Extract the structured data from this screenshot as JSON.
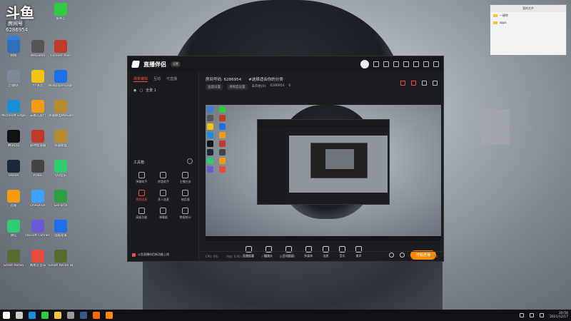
{
  "desktop": {
    "room_badge": {
      "big": "斗鱼",
      "label": "房间号",
      "number": "6286954"
    },
    "icons": [
      {
        "label": "此电脑",
        "color": "#3b7dd8"
      },
      {
        "label": "爱奇艺",
        "color": "#2ecc40"
      },
      {
        "label": "网络",
        "color": "#2d6fb9"
      },
      {
        "label": "WeGame",
        "color": "#555"
      },
      {
        "label": "Forever Plan",
        "color": "#c0392b"
      },
      {
        "label": "回收站",
        "color": "#7a8a99"
      },
      {
        "label": "YY语音",
        "color": "#f1c40f"
      },
      {
        "label": "WallpaperEngine",
        "color": "#1f6feb"
      },
      {
        "label": "Microsoft Edge",
        "color": "#1a8fd8"
      },
      {
        "label": "去哪儿旅行",
        "color": "#f39c12"
      },
      {
        "label": "英雄联盟WeGame版",
        "color": "#b88a2e"
      },
      {
        "label": "腾讯QQ",
        "color": "#111"
      },
      {
        "label": "雷神加速器",
        "color": "#c0392b"
      },
      {
        "label": "英雄联盟",
        "color": "#b88a2e"
      },
      {
        "label": "Steam",
        "color": "#1b2838"
      },
      {
        "label": "PUBG",
        "color": "#444"
      },
      {
        "label": "QQ音乐",
        "color": "#2ecc71"
      },
      {
        "label": "迅雷",
        "color": "#f39c12"
      },
      {
        "label": "OneDrive",
        "color": "#3da0ff"
      },
      {
        "label": "GeForce",
        "color": "#2ea043"
      },
      {
        "label": "微信",
        "color": "#2ecc71"
      },
      {
        "label": "Ubisoft Connect",
        "color": "#6b5bd6"
      },
      {
        "label": "电脑管家",
        "color": "#1f6feb"
      },
      {
        "label": "Ghost Recon",
        "color": "#556b2f"
      },
      {
        "label": "网易云音乐",
        "color": "#e74c3c"
      },
      {
        "label": "Ghost Recon Breakpoint",
        "color": "#556b2f"
      }
    ]
  },
  "app": {
    "title": "直播伴侣",
    "version_badge": "设置",
    "sidebar": {
      "tabs": [
        "场景编辑",
        "互动",
        "可直播"
      ],
      "scene_label": "全景 1",
      "tools_title": "工具箱",
      "tools": [
        {
          "label": "弹幕助手",
          "red": false
        },
        {
          "label": "房管助手",
          "red": false
        },
        {
          "label": "主播任务",
          "red": false
        },
        {
          "label": "视频连麦",
          "red": true
        },
        {
          "label": "多人连麦",
          "red": false
        },
        {
          "label": "抽奖器",
          "red": false
        },
        {
          "label": "高级功能",
          "red": false
        },
        {
          "label": "弹幕姬",
          "red": false
        },
        {
          "label": "数据统计",
          "red": false
        }
      ],
      "notice": "斗鱼直播伴侣新功能上线"
    },
    "room": {
      "title_line": "房间号码: 6286954",
      "category": "#选择适合你的分类",
      "sub_pills": [
        "画面设置",
        "清晰度设置"
      ],
      "sub_text": "未开始(0)",
      "sub_id": "6286954",
      "sub_count": "0"
    },
    "bottom_tools": [
      "直播屏幕",
      "摄像头",
      "手机投屏",
      "多媒体",
      "连麦",
      "音乐",
      "美声"
    ],
    "start_button": "开始直播",
    "status": {
      "cpu": "CPU: 0%",
      "memory": "内存: 0.00 / 0.00GB",
      "fps": "FPS: 0",
      "net": "网速: 0KB/s",
      "time": "00:00:00"
    }
  },
  "mini_window": {
    "title": "我的文件",
    "rows": [
      "一键转",
      "apps"
    ]
  },
  "taskbar": {
    "time": "20:56",
    "date": "2021/12/17",
    "apps": [
      {
        "name": "start",
        "color": "#fff"
      },
      {
        "name": "search",
        "color": "#ccc"
      },
      {
        "name": "edge",
        "color": "#1a8fd8"
      },
      {
        "name": "chrome",
        "color": "#2ecc40"
      },
      {
        "name": "explorer",
        "color": "#f5c542"
      },
      {
        "name": "wegame",
        "color": "#999"
      },
      {
        "name": "steam",
        "color": "#3b5a86"
      },
      {
        "name": "browser2",
        "color": "#ff6a00"
      },
      {
        "name": "douyu",
        "color": "#ff8a00"
      }
    ]
  }
}
